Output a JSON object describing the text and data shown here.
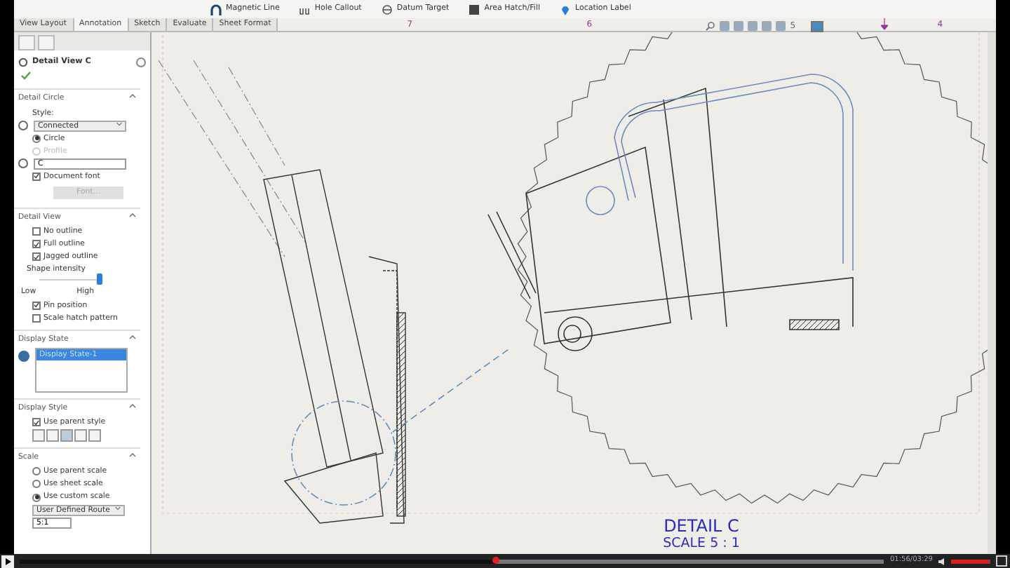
{
  "ribbon": {
    "buttons": [
      {
        "label": "Magnetic Line",
        "kind": "magnet"
      },
      {
        "label": "Hole Callout",
        "kind": "hole"
      },
      {
        "label": "Datum Target",
        "kind": "target"
      },
      {
        "label": "Area Hatch/Fill",
        "kind": "hatch"
      },
      {
        "label": "Location Label",
        "kind": "pin"
      }
    ]
  },
  "tabs": [
    {
      "label": "View Layout",
      "selected": false
    },
    {
      "label": "Annotation",
      "selected": true
    },
    {
      "label": "Sketch",
      "selected": false
    },
    {
      "label": "Evaluate",
      "selected": false
    },
    {
      "label": "Sheet Format",
      "selected": false
    }
  ],
  "ruler": {
    "labels": [
      "7",
      "6",
      "4"
    ]
  },
  "view_toolbar": {
    "count": "5"
  },
  "property_manager": {
    "title": "Detail View C",
    "sections": [
      {
        "title": "Detail Circle",
        "expanded": true,
        "items": [
          {
            "kind": "label",
            "text": "Style:"
          },
          {
            "kind": "select",
            "value": "Connected"
          },
          {
            "kind": "radio",
            "text": "Circle",
            "selected": true,
            "disabled": false
          },
          {
            "kind": "radio",
            "text": "Profile",
            "selected": false,
            "disabled": true
          },
          {
            "kind": "text_input",
            "value": "C"
          },
          {
            "kind": "checkbox",
            "text": "Document font",
            "checked": true
          },
          {
            "kind": "button",
            "text": "Font...",
            "disabled": true
          }
        ]
      },
      {
        "title": "Detail View",
        "expanded": true,
        "items": [
          {
            "kind": "checkbox",
            "text": "No outline",
            "checked": false
          },
          {
            "kind": "checkbox",
            "text": "Full outline",
            "checked": true
          },
          {
            "kind": "checkbox",
            "text": "Jagged outline",
            "checked": true
          },
          {
            "kind": "slider",
            "text": "Shape intensity",
            "min_label": "Low",
            "max_label": "High",
            "level": 0.95
          },
          {
            "kind": "checkbox",
            "text": "Pin position",
            "checked": true
          },
          {
            "kind": "checkbox",
            "text": "Scale hatch pattern",
            "checked": false
          }
        ]
      },
      {
        "title": "Display State",
        "expanded": true,
        "items": [
          {
            "kind": "listbox",
            "options": [
              {
                "text": "Display State-1",
                "selected": true
              }
            ]
          }
        ]
      },
      {
        "title": "Display Style",
        "expanded": true,
        "items": [
          {
            "kind": "checkbox",
            "text": "Use parent style",
            "checked": true
          },
          {
            "kind": "style_buttons",
            "buttons": [
              {
                "selected": false
              },
              {
                "selected": false
              },
              {
                "selected": true
              },
              {
                "selected": false
              },
              {
                "selected": false
              }
            ]
          }
        ]
      },
      {
        "title": "Scale",
        "expanded": true,
        "items": [
          {
            "kind": "radio",
            "text": "Use parent scale",
            "selected": false,
            "disabled": false
          },
          {
            "kind": "radio",
            "text": "Use sheet scale",
            "selected": false,
            "disabled": false
          },
          {
            "kind": "radio",
            "text": "Use custom scale",
            "selected": true,
            "disabled": false
          },
          {
            "kind": "select",
            "value": "User Defined Route"
          },
          {
            "kind": "text_input",
            "value": "5:1"
          }
        ]
      }
    ]
  },
  "drawing": {
    "title": "DETAIL C",
    "scale": "SCALE 5 : 1"
  },
  "player": {
    "time": "01:56/03:29",
    "progress": {
      "level": 0.55
    },
    "volume": {
      "level": 0.95
    }
  }
}
